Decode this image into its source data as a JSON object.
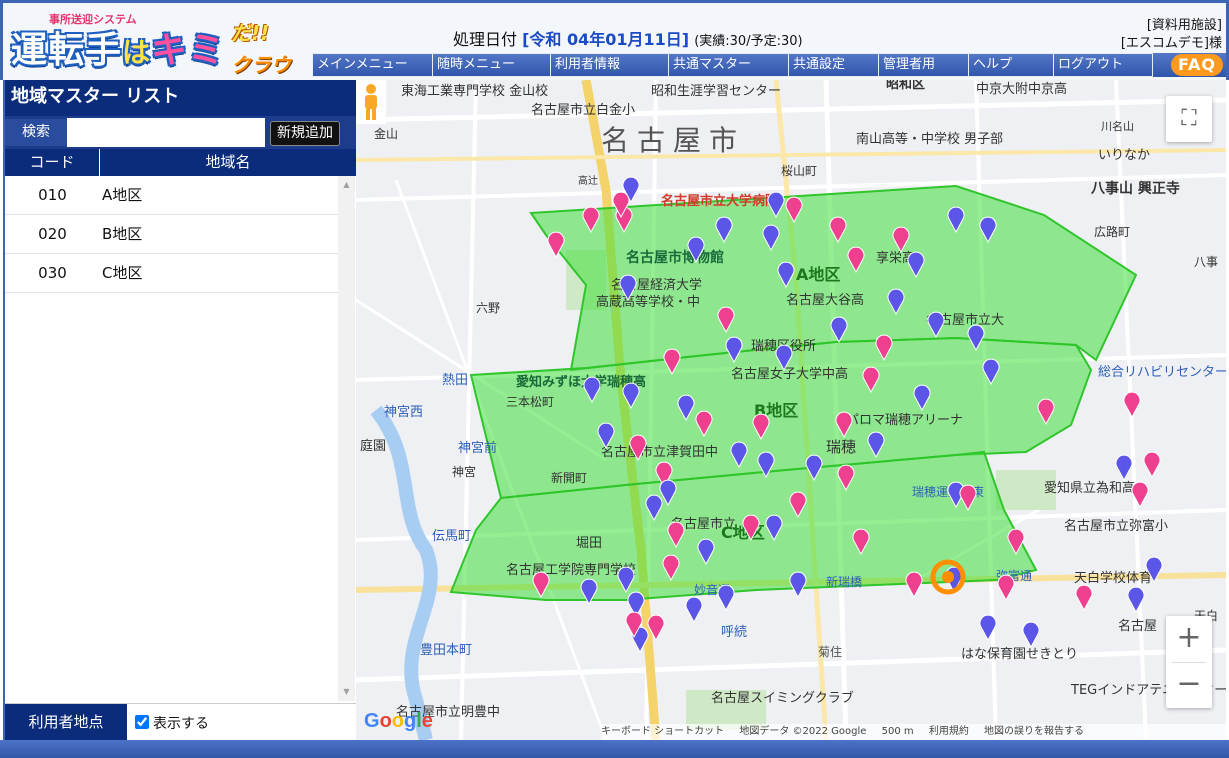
{
  "header": {
    "logo_sub": "事所送迎システム",
    "logo_main_a": "運転手",
    "logo_main_b": "は",
    "logo_main_c": "キミ",
    "logo_da": "だ!!",
    "logo_cloud": "クラウド",
    "proc_date_label": "処理日付",
    "proc_date_value": "[令和 04年01月11日]",
    "proc_date_counts": "(実績:30/予定:30)",
    "facility_line1": "[資料用施設]",
    "facility_line2": "[エスコムデモ]様"
  },
  "nav": {
    "items": [
      "メインメニュー",
      "随時メニュー",
      "利用者情報",
      "共通マスター",
      "共通設定",
      "管理者用",
      "ヘルプ",
      "ログアウト"
    ],
    "faq": "FAQ"
  },
  "left": {
    "title": "地域マスター リスト",
    "search_label": "検索",
    "search_value": "",
    "add_button": "新規追加",
    "col_code": "コード",
    "col_name": "地域名",
    "rows": [
      {
        "code": "010",
        "name": "A地区"
      },
      {
        "code": "020",
        "name": "B地区"
      },
      {
        "code": "030",
        "name": "C地区"
      }
    ],
    "user_point_label": "利用者地点",
    "show_label": "表示する",
    "show_checked": true
  },
  "map": {
    "region_labels": [
      "A地区",
      "B地区",
      "C地区"
    ],
    "place_labels": [
      "名古屋市",
      "名古屋市立大学病院",
      "名古屋市博物館",
      "名古屋経済大学",
      "高蔵高等学校・中",
      "名古屋大谷高",
      "享栄高",
      "名古屋市立大",
      "瑞穂区役所",
      "名古屋女子大学中高",
      "愛知みずほ大学瑞穂高",
      "パロマ瑞穂アリーナ",
      "瑞穂",
      "名古屋市立津賀田中",
      "名古屋市立",
      "名古屋工学院専門学校",
      "堀田",
      "新瑞橋",
      "呼続",
      "名古屋スイミングクラブ",
      "はな保育園せきとり",
      "愛知県立為和高",
      "名古屋市立弥富小",
      "天白学校体育",
      "名古屋",
      "TEGインドアテニススクール",
      "昭和生涯学習センター",
      "名古屋市立白金小",
      "東海工業専門学校 金山校",
      "南山高等・中学校 男子部",
      "中京大附中京高",
      "八事山 興正寺",
      "総合リハビリセンター",
      "金山",
      "六野",
      "熱田",
      "三本松町",
      "神宮西",
      "神宮前",
      "伝馬町",
      "豊田本町",
      "名古屋市立明豊中",
      "菊住",
      "広路町",
      "桜山町",
      "高辻",
      "いりなか",
      "八事",
      "昭和区",
      "川名山",
      "瑞穂運動場東",
      "神宮",
      "新開町",
      "妙音通",
      "弥富通",
      "庭園",
      "天白"
    ],
    "fullscreen": "⛶",
    "zoom_in": "+",
    "zoom_out": "−",
    "google": "Google",
    "attrib_shortcuts": "キーボード ショートカット",
    "attrib_data": "地図データ ©2022 Google",
    "attrib_scale": "500 m",
    "attrib_terms": "利用規約",
    "attrib_report": "地図の誤りを報告する",
    "colors": {
      "area_fill": "#3fe03a",
      "area_stroke": "#2fc52b",
      "pin_pink": "#ef3f8f",
      "pin_blue": "#5b55e8"
    }
  }
}
